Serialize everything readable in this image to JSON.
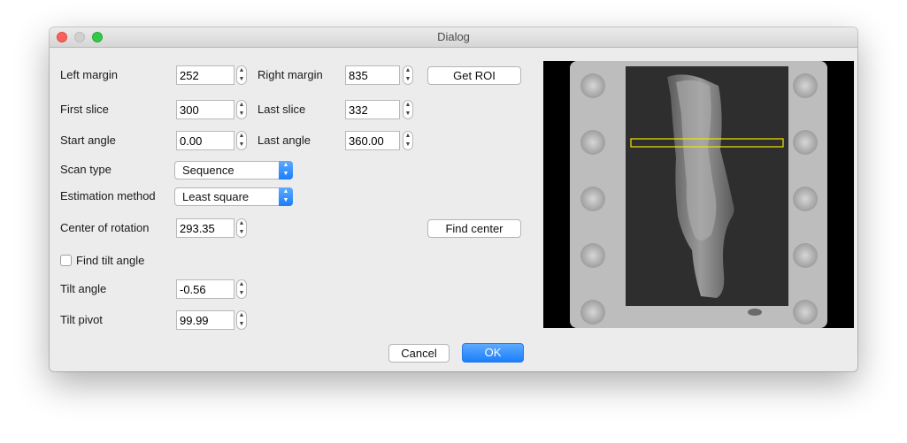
{
  "window": {
    "title": "Dialog"
  },
  "form": {
    "left_margin": {
      "label": "Left margin",
      "value": "252"
    },
    "right_margin": {
      "label": "Right margin",
      "value": "835"
    },
    "get_roi": "Get ROI",
    "first_slice": {
      "label": "First slice",
      "value": "300"
    },
    "last_slice": {
      "label": "Last slice",
      "value": "332"
    },
    "start_angle": {
      "label": "Start angle",
      "value": "0.00"
    },
    "last_angle": {
      "label": "Last angle",
      "value": "360.00"
    },
    "scan_type": {
      "label": "Scan type",
      "value": "Sequence"
    },
    "estimation_method": {
      "label": "Estimation method",
      "value": "Least square"
    },
    "center_of_rotation": {
      "label": "Center of rotation",
      "value": "293.35"
    },
    "find_center": "Find center",
    "find_tilt_angle": {
      "label": "Find tilt angle",
      "checked": false
    },
    "tilt_angle": {
      "label": "Tilt angle",
      "value": "-0.56"
    },
    "tilt_pivot": {
      "label": "Tilt pivot",
      "value": "99.99"
    }
  },
  "buttons": {
    "cancel": "Cancel",
    "ok": "OK"
  },
  "icons": {
    "stepper": "up-down-stepper-icon",
    "combo": "up-down-chevron-icon",
    "window_controls": [
      "close-icon",
      "minimize-icon",
      "maximize-icon"
    ]
  },
  "colors": {
    "accent": "#1b7ffb",
    "roi_box": "#f2e600",
    "close_light": "#fc605c",
    "maximize_light": "#34c84a"
  }
}
